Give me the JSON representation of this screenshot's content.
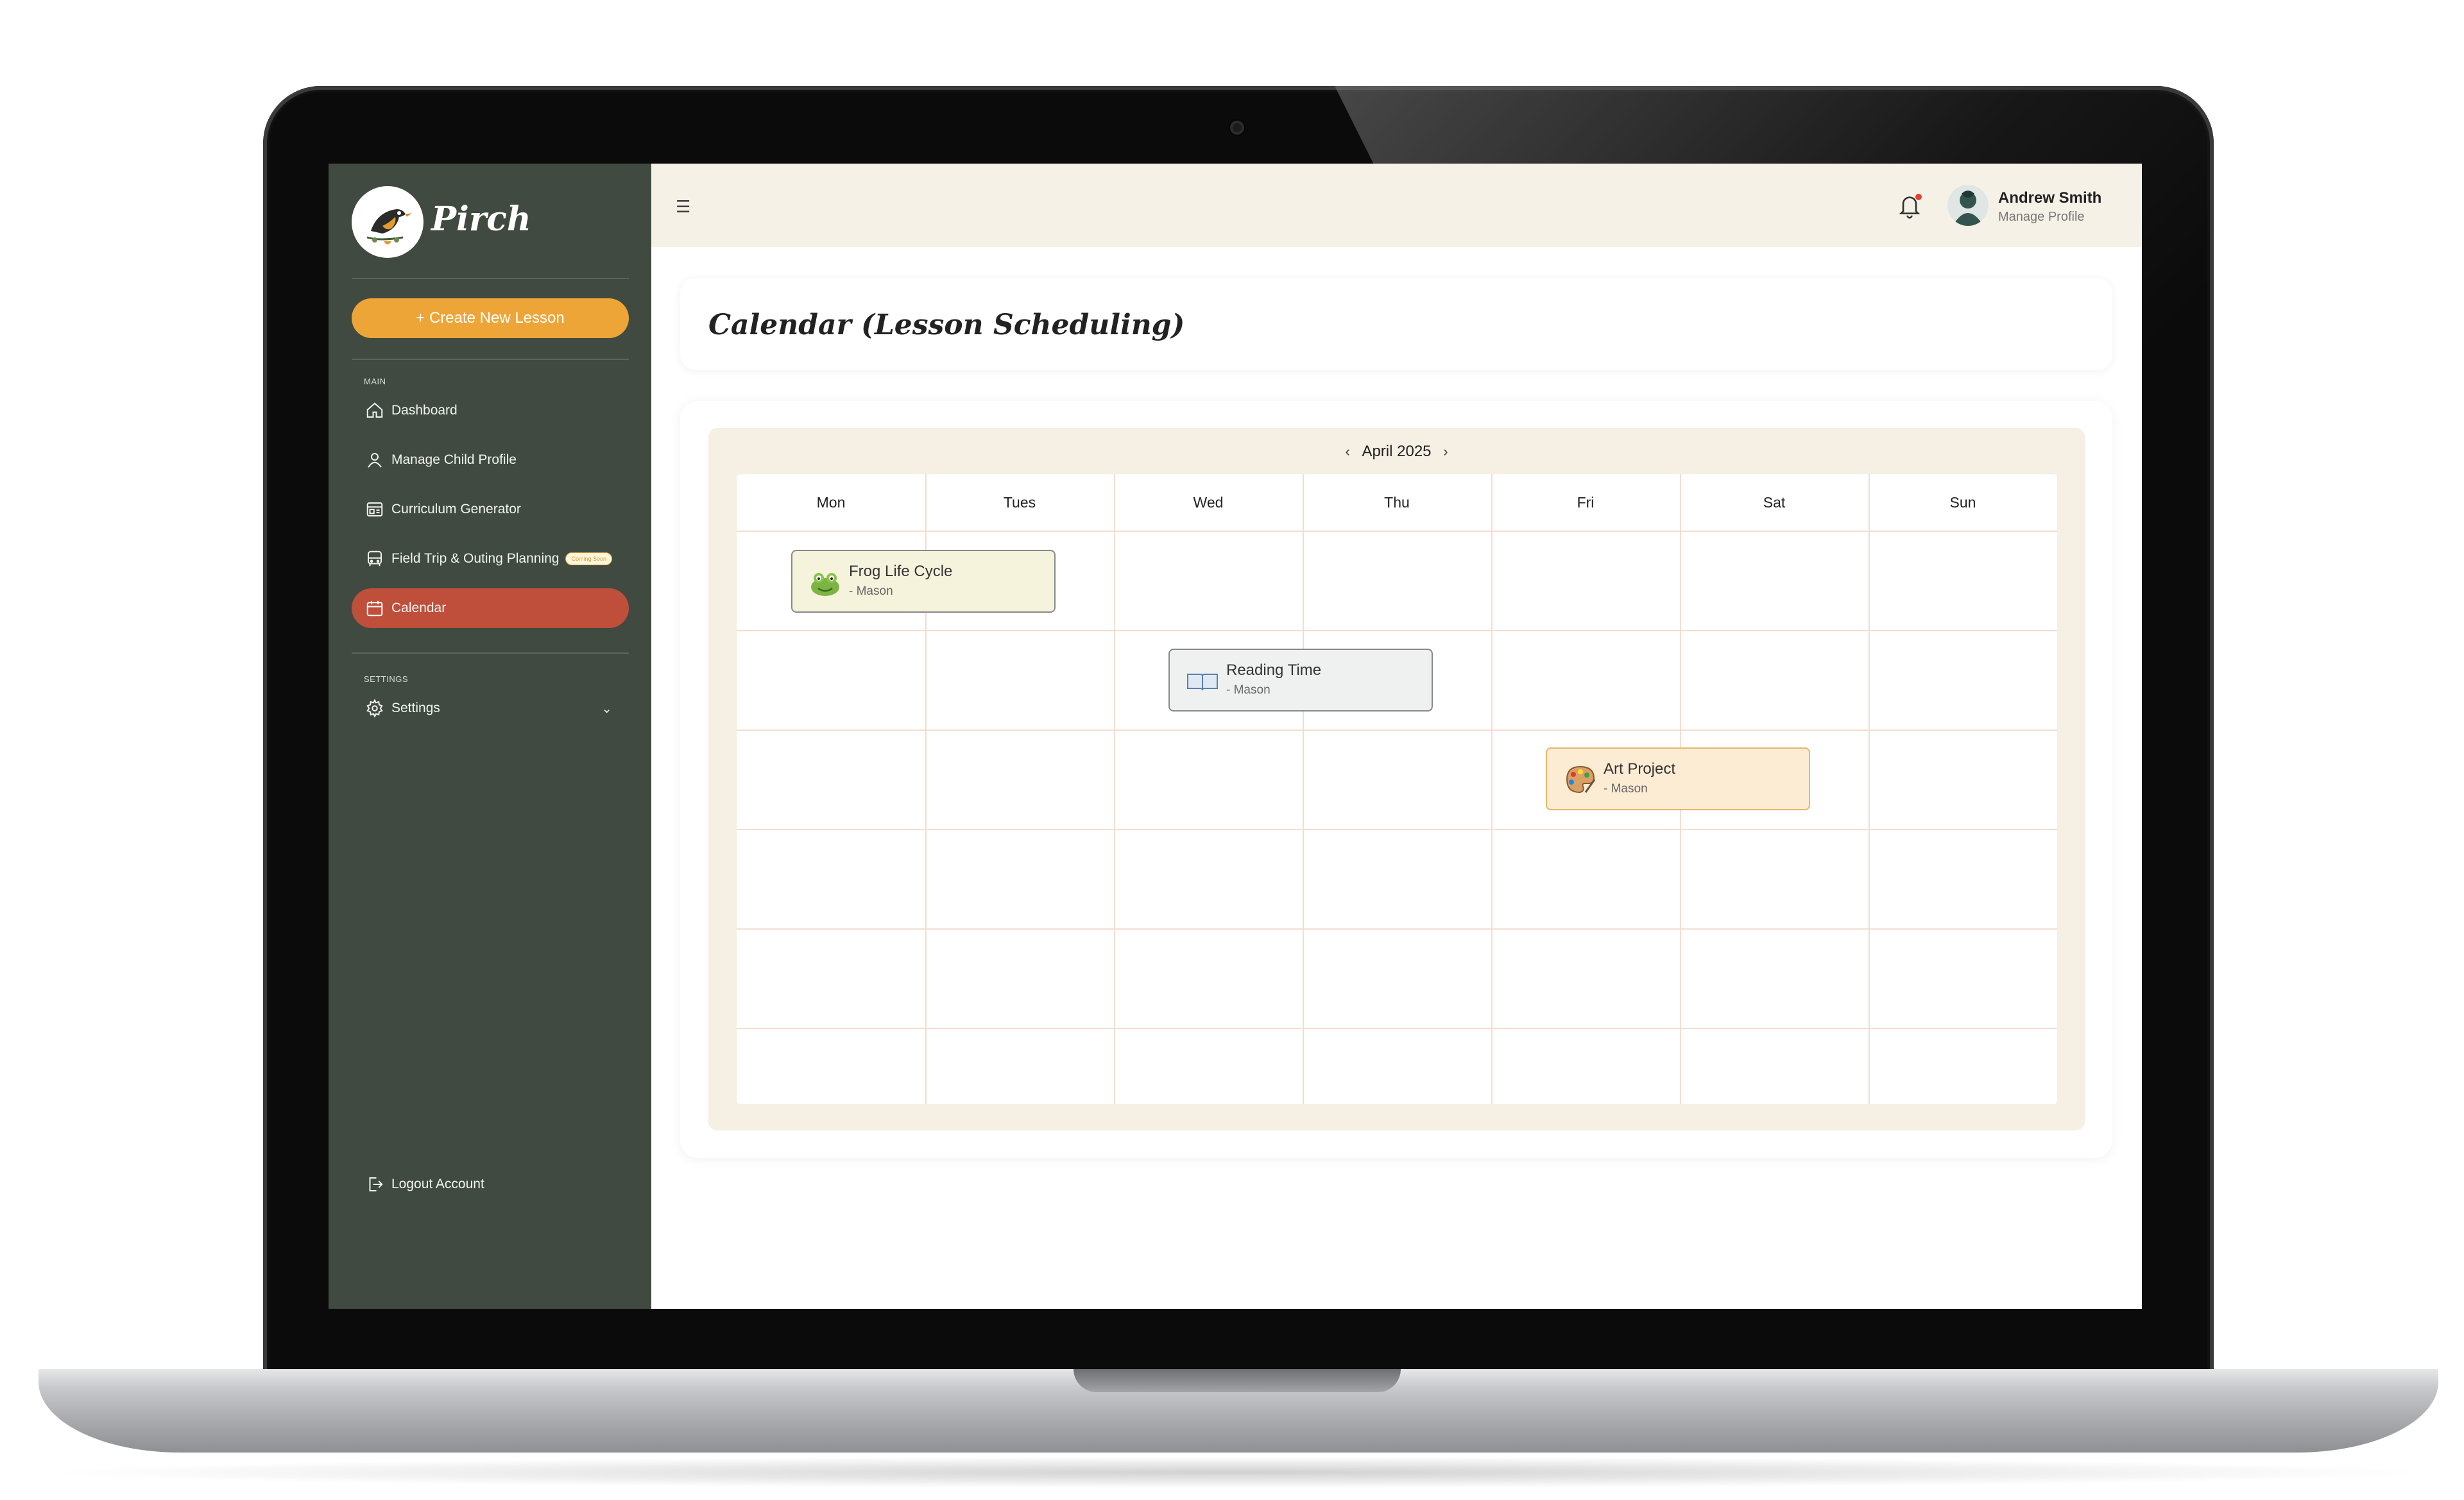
{
  "app": {
    "brand": "Pirch"
  },
  "sidebar": {
    "create_button": "+ Create New Lesson",
    "main_section": "MAIN",
    "items": [
      {
        "label": "Dashboard",
        "icon": "home-icon"
      },
      {
        "label": "Manage Child Profile",
        "icon": "user-icon"
      },
      {
        "label": "Curriculum Generator",
        "icon": "curriculum-icon"
      },
      {
        "label": "Field Trip & Outing Planning",
        "icon": "bus-icon",
        "badge": "Coming Soon"
      },
      {
        "label": "Calendar",
        "icon": "calendar-icon",
        "active": true
      }
    ],
    "settings_section": "SETTINGS",
    "settings_label": "Settings",
    "logout_label": "Logout Account"
  },
  "topbar": {
    "menu_icon": "hamburger-icon",
    "notification_icon": "bell-icon",
    "user_name": "Andrew Smith",
    "user_sub": "Manage Profile"
  },
  "page": {
    "title": "Calendar (Lesson Scheduling)"
  },
  "calendar": {
    "month": "April 2025",
    "days": [
      "Mon",
      "Tues",
      "Wed",
      "Thu",
      "Fri",
      "Sat",
      "Sun"
    ],
    "events": [
      {
        "title": "Frog Life Cycle",
        "sub": "- Mason",
        "icon": "frog-icon",
        "color": "#f5f3dc"
      },
      {
        "title": "Reading Time",
        "sub": "- Mason",
        "icon": "book-icon",
        "color": "#eef1ef"
      },
      {
        "title": "Art Project",
        "sub": "- Mason",
        "icon": "palette-icon",
        "color": "#fdecd4"
      }
    ]
  },
  "colors": {
    "sidebar": "#404a40",
    "accent_orange": "#eea537",
    "active_red": "#bf4f3b",
    "topbar": "#f6f1e7",
    "calendar_bg": "#f5efe4"
  }
}
